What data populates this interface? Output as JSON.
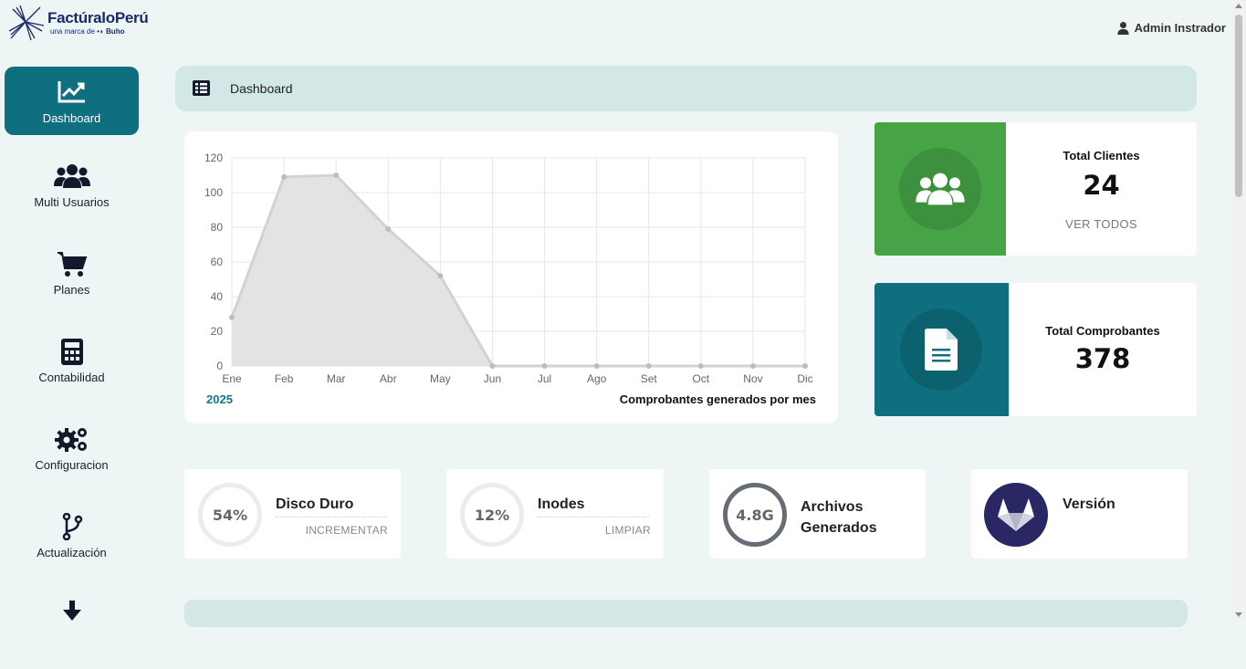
{
  "header": {
    "brand": "FactúraloPerú",
    "brand_sub_prefix": "una marca de",
    "brand_sub_partner": "Buho",
    "user_name": "Admin Instrador"
  },
  "sidebar": {
    "items": [
      {
        "label": "Dashboard",
        "icon": "chart-line-icon",
        "active": true
      },
      {
        "label": "Multi Usuarios",
        "icon": "users-icon"
      },
      {
        "label": "Planes",
        "icon": "cart-icon"
      },
      {
        "label": "Contabilidad",
        "icon": "calculator-icon"
      },
      {
        "label": "Configuracion",
        "icon": "gears-icon"
      },
      {
        "label": "Actualización",
        "icon": "branch-icon"
      },
      {
        "label": "",
        "icon": "download-icon"
      }
    ]
  },
  "breadcrumb": {
    "label": "Dashboard",
    "icon": "list-icon"
  },
  "chart_data": {
    "type": "area",
    "categories": [
      "Ene",
      "Feb",
      "Mar",
      "Abr",
      "May",
      "Jun",
      "Jul",
      "Ago",
      "Set",
      "Oct",
      "Nov",
      "Dic"
    ],
    "values": [
      28,
      109,
      110,
      79,
      52,
      0,
      0,
      0,
      0,
      0,
      0,
      0
    ],
    "ylim": [
      0,
      120
    ],
    "yticks": [
      0,
      20,
      40,
      60,
      80,
      100,
      120
    ],
    "grid": true,
    "year_label": "2025",
    "caption": "Comprobantes generados por mes",
    "colors": {
      "fill": "#e3e3e3",
      "line": "#d2d2d2",
      "point": "#bdbdbd"
    }
  },
  "stats": {
    "clientes": {
      "title": "Total Clientes",
      "value": "24",
      "link": "VER TODOS",
      "color": "#46a446",
      "icon": "users-icon"
    },
    "comprobantes": {
      "title": "Total Comprobantes",
      "value": "378",
      "color": "#0e6f7f",
      "icon": "file-icon"
    }
  },
  "info": {
    "disco": {
      "percent": "54%",
      "name": "Disco Duro",
      "action": "INCREMENTAR"
    },
    "inodes": {
      "percent": "12%",
      "name": "Inodes",
      "action": "LIMPIAR"
    },
    "archivos": {
      "size": "4.8G",
      "name_line1": "Archivos",
      "name_line2": "Generados"
    },
    "version": {
      "name": "Versión",
      "icon": "gitlab-icon"
    }
  }
}
